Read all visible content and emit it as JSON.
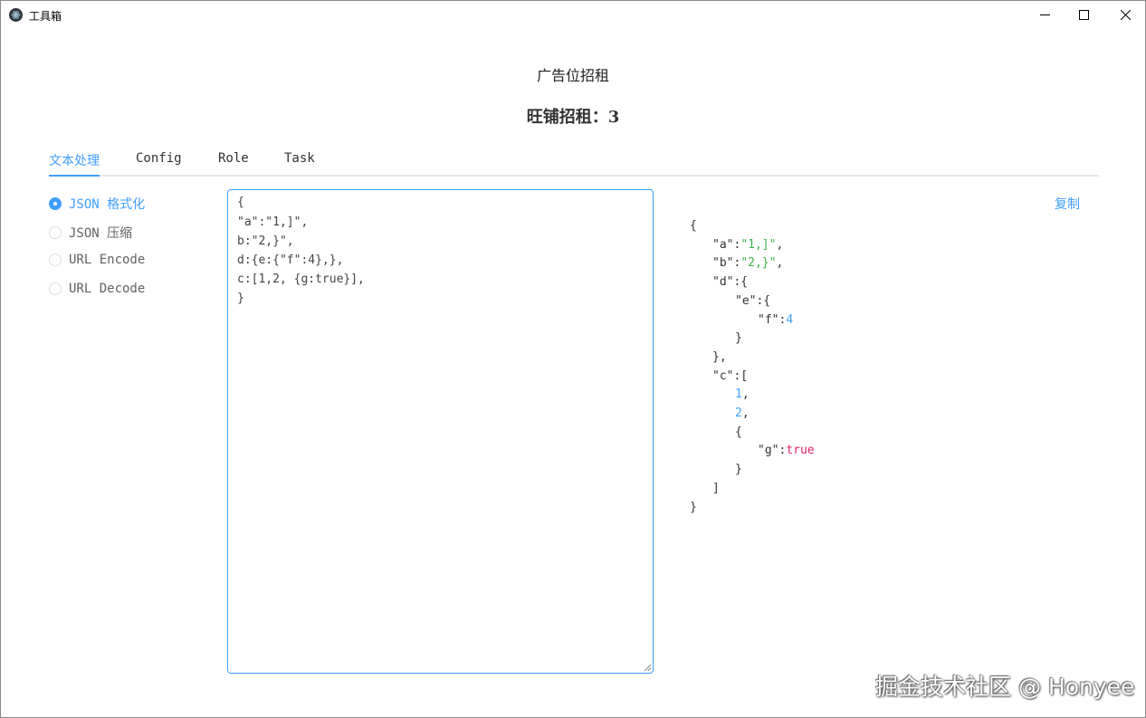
{
  "window": {
    "title": "工具箱",
    "controls": {
      "minimize_icon": "minimize-icon",
      "maximize_icon": "maximize-icon",
      "close_icon": "close-icon"
    }
  },
  "header": {
    "ad_text": "广告位招租",
    "shop_text": "旺铺招租：3"
  },
  "tabs": [
    {
      "label": "文本处理",
      "active": true
    },
    {
      "label": "Config",
      "active": false
    },
    {
      "label": "Role",
      "active": false
    },
    {
      "label": "Task",
      "active": false
    }
  ],
  "options": [
    {
      "label": "JSON 格式化",
      "checked": true
    },
    {
      "label": "JSON 压缩",
      "checked": false
    },
    {
      "label": "URL Encode",
      "checked": false
    },
    {
      "label": "URL Decode",
      "checked": false
    }
  ],
  "editor": {
    "lines": [
      "{",
      "\"a\":\"1,]\",",
      "b:\"2,}\",",
      "d:{e:{\"f\":4},},",
      "c:[1,2, {g:true}],",
      "}"
    ]
  },
  "output": {
    "copy_label": "复制",
    "lines": [
      {
        "indent": 0,
        "parts": [
          {
            "t": "p",
            "v": "{"
          }
        ]
      },
      {
        "indent": 1,
        "parts": [
          {
            "t": "k",
            "v": "\"a\""
          },
          {
            "t": "p",
            "v": ":"
          },
          {
            "t": "s",
            "v": "\"1,]\""
          },
          {
            "t": "p",
            "v": ","
          }
        ]
      },
      {
        "indent": 1,
        "parts": [
          {
            "t": "k",
            "v": "\"b\""
          },
          {
            "t": "p",
            "v": ":"
          },
          {
            "t": "s",
            "v": "\"2,}\""
          },
          {
            "t": "p",
            "v": ","
          }
        ]
      },
      {
        "indent": 1,
        "parts": [
          {
            "t": "k",
            "v": "\"d\""
          },
          {
            "t": "p",
            "v": ":{"
          }
        ]
      },
      {
        "indent": 2,
        "parts": [
          {
            "t": "k",
            "v": "\"e\""
          },
          {
            "t": "p",
            "v": ":{"
          }
        ]
      },
      {
        "indent": 3,
        "parts": [
          {
            "t": "k",
            "v": "\"f\""
          },
          {
            "t": "p",
            "v": ":"
          },
          {
            "t": "n",
            "v": "4"
          }
        ]
      },
      {
        "indent": 2,
        "parts": [
          {
            "t": "p",
            "v": "}"
          }
        ]
      },
      {
        "indent": 1,
        "parts": [
          {
            "t": "p",
            "v": "},"
          }
        ]
      },
      {
        "indent": 1,
        "parts": [
          {
            "t": "k",
            "v": "\"c\""
          },
          {
            "t": "p",
            "v": ":["
          }
        ]
      },
      {
        "indent": 2,
        "parts": [
          {
            "t": "n",
            "v": "1"
          },
          {
            "t": "p",
            "v": ","
          }
        ]
      },
      {
        "indent": 2,
        "parts": [
          {
            "t": "n",
            "v": "2"
          },
          {
            "t": "p",
            "v": ","
          }
        ]
      },
      {
        "indent": 2,
        "parts": [
          {
            "t": "p",
            "v": "{"
          }
        ]
      },
      {
        "indent": 3,
        "parts": [
          {
            "t": "k",
            "v": "\"g\""
          },
          {
            "t": "p",
            "v": ":"
          },
          {
            "t": "b",
            "v": "true"
          }
        ]
      },
      {
        "indent": 2,
        "parts": [
          {
            "t": "p",
            "v": "}"
          }
        ]
      },
      {
        "indent": 1,
        "parts": [
          {
            "t": "p",
            "v": "]"
          }
        ]
      },
      {
        "indent": 0,
        "parts": [
          {
            "t": "p",
            "v": "}"
          }
        ]
      }
    ]
  },
  "watermark": "掘金技术社区 @ Honyee",
  "colors": {
    "accent": "#409eff",
    "string": "#3bb34a",
    "number": "#409eff",
    "boolean": "#e0245e"
  }
}
